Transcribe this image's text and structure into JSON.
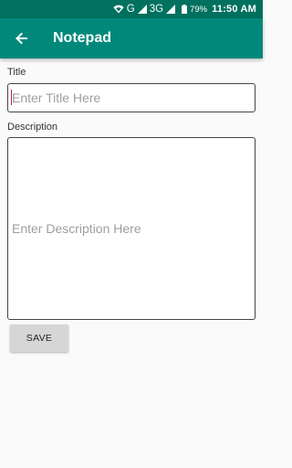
{
  "status_bar": {
    "network_label": "G",
    "network_3g": "3G",
    "battery_percent": "79%",
    "time": "11:50 AM",
    "icons": [
      "wifi-icon",
      "signal-icon",
      "signal-icon",
      "battery-icon"
    ]
  },
  "app_bar": {
    "title": "Notepad",
    "back_icon": "arrow-back-icon",
    "background": "#00897b"
  },
  "form": {
    "title_label": "Title",
    "title_placeholder": "Enter Title Here",
    "title_value": "",
    "description_label": "Description",
    "description_placeholder": "Enter Description Here",
    "description_value": "",
    "save_label": "SAVE"
  },
  "colors": {
    "status_bar": "#00705f",
    "app_bar": "#00897b",
    "cursor": "#c2185b",
    "button": "#d6d6d6"
  }
}
